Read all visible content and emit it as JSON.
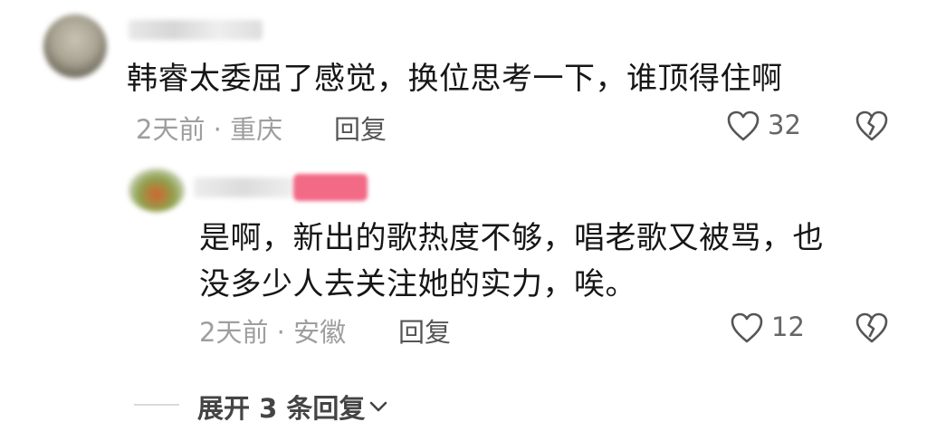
{
  "comment": {
    "text": "韩睿太委屈了感觉，换位思考一下，谁顶得住啊",
    "meta": "2天前 · 重庆",
    "reply_label": "回复",
    "like_count": "32"
  },
  "reply": {
    "text_line1": "是啊，新出的歌热度不够，唱老歌又被骂，也",
    "text_line2": "没多少人去关注她的实力，唉。",
    "meta": "2天前 · 安徽",
    "reply_label": "回复",
    "like_count": "12"
  },
  "expand": {
    "label": "展开 3 条回复"
  },
  "icons": {
    "like": "heart-outline-icon",
    "dislike": "broken-heart-icon",
    "expand": "chevron-down-icon"
  }
}
